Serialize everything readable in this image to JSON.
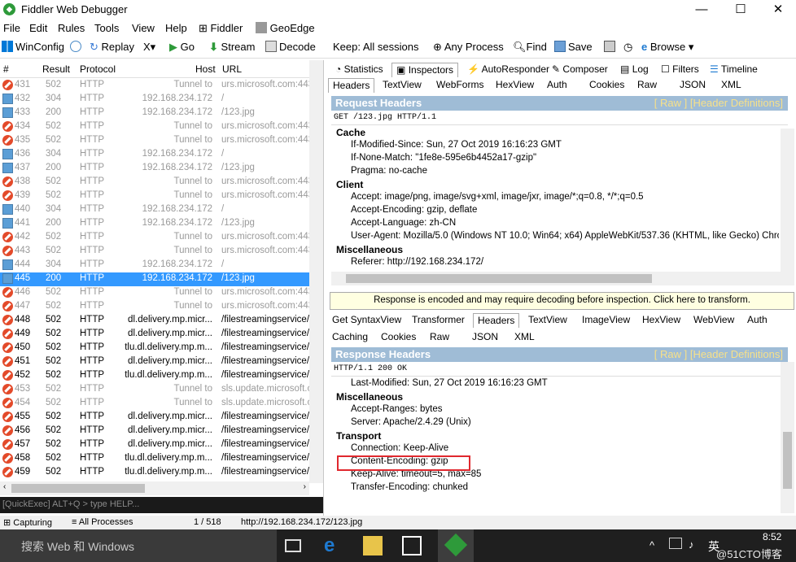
{
  "window": {
    "title": "Fiddler Web Debugger",
    "minimize": "—",
    "maximize": "☐",
    "close": "✕"
  },
  "menu": [
    "File",
    "Edit",
    "Rules",
    "Tools",
    "View",
    "Help",
    "Fiddler",
    "GeoEdge"
  ],
  "toolbar": {
    "winconfig": "WinConfig",
    "replay": "Replay",
    "x_drop": "X▾",
    "go": "Go",
    "stream": "Stream",
    "decode": "Decode",
    "keep": "Keep: All sessions",
    "any_process": "Any Process",
    "find": "Find",
    "save": "Save",
    "browse": "Browse"
  },
  "session_list": {
    "headers": {
      "num": "#",
      "result": "Result",
      "protocol": "Protocol",
      "host": "Host",
      "url": "URL"
    },
    "rows": [
      {
        "num": "431",
        "result": "502",
        "protocol": "HTTP",
        "host": "Tunnel to",
        "url": "urs.microsoft.com:443",
        "icon": "error",
        "gray": true
      },
      {
        "num": "432",
        "result": "304",
        "protocol": "HTTP",
        "host": "192.168.234.172",
        "url": "/",
        "icon": "img",
        "gray": true
      },
      {
        "num": "433",
        "result": "200",
        "protocol": "HTTP",
        "host": "192.168.234.172",
        "url": "/123.jpg",
        "icon": "img",
        "gray": true
      },
      {
        "num": "434",
        "result": "502",
        "protocol": "HTTP",
        "host": "Tunnel to",
        "url": "urs.microsoft.com:443",
        "icon": "error",
        "gray": true
      },
      {
        "num": "435",
        "result": "502",
        "protocol": "HTTP",
        "host": "Tunnel to",
        "url": "urs.microsoft.com:443",
        "icon": "error",
        "gray": true
      },
      {
        "num": "436",
        "result": "304",
        "protocol": "HTTP",
        "host": "192.168.234.172",
        "url": "/",
        "icon": "img",
        "gray": true
      },
      {
        "num": "437",
        "result": "200",
        "protocol": "HTTP",
        "host": "192.168.234.172",
        "url": "/123.jpg",
        "icon": "img",
        "gray": true
      },
      {
        "num": "438",
        "result": "502",
        "protocol": "HTTP",
        "host": "Tunnel to",
        "url": "urs.microsoft.com:443",
        "icon": "error",
        "gray": true
      },
      {
        "num": "439",
        "result": "502",
        "protocol": "HTTP",
        "host": "Tunnel to",
        "url": "urs.microsoft.com:443",
        "icon": "error",
        "gray": true
      },
      {
        "num": "440",
        "result": "304",
        "protocol": "HTTP",
        "host": "192.168.234.172",
        "url": "/",
        "icon": "img",
        "gray": true
      },
      {
        "num": "441",
        "result": "200",
        "protocol": "HTTP",
        "host": "192.168.234.172",
        "url": "/123.jpg",
        "icon": "img",
        "gray": true
      },
      {
        "num": "442",
        "result": "502",
        "protocol": "HTTP",
        "host": "Tunnel to",
        "url": "urs.microsoft.com:443",
        "icon": "error",
        "gray": true
      },
      {
        "num": "443",
        "result": "502",
        "protocol": "HTTP",
        "host": "Tunnel to",
        "url": "urs.microsoft.com:443",
        "icon": "error",
        "gray": true
      },
      {
        "num": "444",
        "result": "304",
        "protocol": "HTTP",
        "host": "192.168.234.172",
        "url": "/",
        "icon": "img",
        "gray": true
      },
      {
        "num": "445",
        "result": "200",
        "protocol": "HTTP",
        "host": "192.168.234.172",
        "url": "/123.jpg",
        "icon": "img",
        "gray": false,
        "selected": true
      },
      {
        "num": "446",
        "result": "502",
        "protocol": "HTTP",
        "host": "Tunnel to",
        "url": "urs.microsoft.com:443",
        "icon": "error",
        "gray": true
      },
      {
        "num": "447",
        "result": "502",
        "protocol": "HTTP",
        "host": "Tunnel to",
        "url": "urs.microsoft.com:443",
        "icon": "error",
        "gray": true
      },
      {
        "num": "448",
        "result": "502",
        "protocol": "HTTP",
        "host": "dl.delivery.mp.micr...",
        "url": "/filestreamingservice/f",
        "icon": "error",
        "gray": false
      },
      {
        "num": "449",
        "result": "502",
        "protocol": "HTTP",
        "host": "dl.delivery.mp.micr...",
        "url": "/filestreamingservice/f",
        "icon": "error",
        "gray": false
      },
      {
        "num": "450",
        "result": "502",
        "protocol": "HTTP",
        "host": "tlu.dl.delivery.mp.m...",
        "url": "/filestreamingservice/f",
        "icon": "error",
        "gray": false
      },
      {
        "num": "451",
        "result": "502",
        "protocol": "HTTP",
        "host": "dl.delivery.mp.micr...",
        "url": "/filestreamingservice/f",
        "icon": "error",
        "gray": false
      },
      {
        "num": "452",
        "result": "502",
        "protocol": "HTTP",
        "host": "tlu.dl.delivery.mp.m...",
        "url": "/filestreamingservice/f",
        "icon": "error",
        "gray": false
      },
      {
        "num": "453",
        "result": "502",
        "protocol": "HTTP",
        "host": "Tunnel to",
        "url": "sls.update.microsoft.c",
        "icon": "error",
        "gray": true
      },
      {
        "num": "454",
        "result": "502",
        "protocol": "HTTP",
        "host": "Tunnel to",
        "url": "sls.update.microsoft.c",
        "icon": "error",
        "gray": true
      },
      {
        "num": "455",
        "result": "502",
        "protocol": "HTTP",
        "host": "dl.delivery.mp.micr...",
        "url": "/filestreamingservice/f",
        "icon": "error",
        "gray": false
      },
      {
        "num": "456",
        "result": "502",
        "protocol": "HTTP",
        "host": "dl.delivery.mp.micr...",
        "url": "/filestreamingservice/f",
        "icon": "error",
        "gray": false
      },
      {
        "num": "457",
        "result": "502",
        "protocol": "HTTP",
        "host": "dl.delivery.mp.micr...",
        "url": "/filestreamingservice/f",
        "icon": "error",
        "gray": false
      },
      {
        "num": "458",
        "result": "502",
        "protocol": "HTTP",
        "host": "tlu.dl.delivery.mp.m...",
        "url": "/filestreamingservice/f",
        "icon": "error",
        "gray": false
      },
      {
        "num": "459",
        "result": "502",
        "protocol": "HTTP",
        "host": "tlu.dl.delivery.mp.m...",
        "url": "/filestreamingservice/f",
        "icon": "error",
        "gray": false
      }
    ]
  },
  "quickexec": "[QuickExec] ALT+Q > type HELP...",
  "top_tabs": [
    "Statistics",
    "Inspectors",
    "AutoResponder",
    "Composer",
    "Log",
    "Filters",
    "Timeline"
  ],
  "request_tabs": [
    "Headers",
    "TextView",
    "WebForms",
    "HexView",
    "Auth",
    "Cookies",
    "Raw",
    "JSON",
    "XML"
  ],
  "request": {
    "title": "Request Headers",
    "links": "[ Raw ]   [Header Definitions]",
    "line": "GET /123.jpg HTTP/1.1",
    "groups": [
      {
        "name": "Cache",
        "items": [
          "If-Modified-Since: Sun, 27 Oct 2019 16:16:23 GMT",
          "If-None-Match: \"1fe8e-595e6b4452a17-gzip\"",
          "Pragma: no-cache"
        ]
      },
      {
        "name": "Client",
        "items": [
          "Accept: image/png, image/svg+xml, image/jxr, image/*;q=0.8, */*;q=0.5",
          "Accept-Encoding: gzip, deflate",
          "Accept-Language: zh-CN",
          "User-Agent: Mozilla/5.0 (Windows NT 10.0; Win64; x64) AppleWebKit/537.36 (KHTML, like Gecko) Chrome/42"
        ]
      },
      {
        "name": "Miscellaneous",
        "items": [
          "Referer: http://192.168.234.172/"
        ]
      }
    ]
  },
  "warning": "Response is encoded and may require decoding before inspection. Click here to transform.",
  "response_tabs_1": [
    "Get SyntaxView",
    "Transformer",
    "Headers",
    "TextView",
    "ImageView",
    "HexView",
    "WebView",
    "Auth"
  ],
  "response_tabs_2": [
    "Caching",
    "Cookies",
    "Raw",
    "JSON",
    "XML"
  ],
  "response": {
    "title": "Response Headers",
    "links": "[ Raw ]   [Header Definitions]",
    "line": "HTTP/1.1 200 OK",
    "last_modified": "Last-Modified: Sun, 27 Oct 2019 16:16:23 GMT",
    "misc_title": "Miscellaneous",
    "misc": [
      "Accept-Ranges: bytes",
      "Server: Apache/2.4.29 (Unix)"
    ],
    "transport_title": "Transport",
    "transport": [
      "Connection: Keep-Alive",
      "Content-Encoding: gzip",
      "Keep-Alive: timeout=5, max=85",
      "Transfer-Encoding: chunked"
    ]
  },
  "status": {
    "capturing": "Capturing",
    "processes": "All Processes",
    "count": "1 / 518",
    "url": "http://192.168.234.172/123.jpg"
  },
  "taskbar": {
    "search": "搜索 Web 和 Windows",
    "time": "8:52",
    "ime": "英",
    "watermark": "@51CTO博客"
  }
}
